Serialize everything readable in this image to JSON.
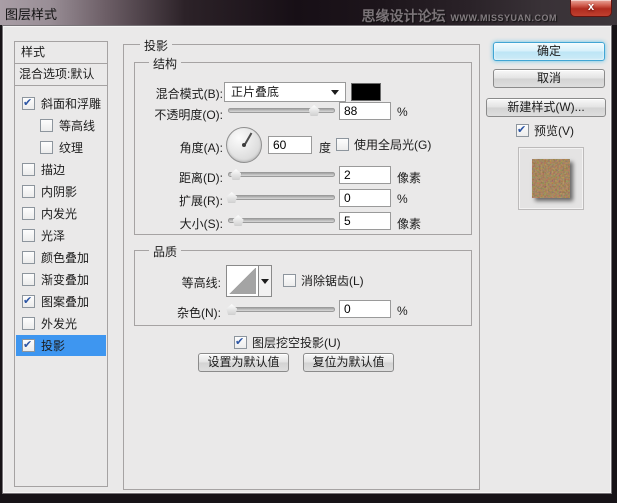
{
  "window": {
    "title": "图层样式",
    "watermark_main": "思缘设计论坛",
    "watermark_sub": "WWW.MISSYUAN.COM",
    "close_label": "x"
  },
  "sidebar": {
    "header": "样式",
    "blending_options": "混合选项:默认",
    "items": [
      {
        "label": "斜面和浮雕",
        "checked": true,
        "indent": false,
        "selected": false
      },
      {
        "label": "等高线",
        "checked": false,
        "indent": true,
        "selected": false
      },
      {
        "label": "纹理",
        "checked": false,
        "indent": true,
        "selected": false
      },
      {
        "label": "描边",
        "checked": false,
        "indent": false,
        "selected": false
      },
      {
        "label": "内阴影",
        "checked": false,
        "indent": false,
        "selected": false
      },
      {
        "label": "内发光",
        "checked": false,
        "indent": false,
        "selected": false
      },
      {
        "label": "光泽",
        "checked": false,
        "indent": false,
        "selected": false
      },
      {
        "label": "颜色叠加",
        "checked": false,
        "indent": false,
        "selected": false
      },
      {
        "label": "渐变叠加",
        "checked": false,
        "indent": false,
        "selected": false
      },
      {
        "label": "图案叠加",
        "checked": true,
        "indent": false,
        "selected": false
      },
      {
        "label": "外发光",
        "checked": false,
        "indent": false,
        "selected": false
      },
      {
        "label": "投影",
        "checked": true,
        "indent": false,
        "selected": true
      }
    ]
  },
  "panel": {
    "group_title": "投影",
    "structure": {
      "title": "结构",
      "blend_mode_label": "混合模式(B):",
      "blend_mode_value": "正片叠底",
      "shadow_color": "#000000",
      "opacity_label": "不透明度(O):",
      "opacity_value": "88",
      "opacity_unit": "%",
      "angle_label": "角度(A):",
      "angle_value": "60",
      "angle_unit": "度",
      "angle_degrees": 60,
      "global_light_label": "使用全局光(G)",
      "distance_label": "距离(D):",
      "distance_value": "2",
      "distance_unit": "像素",
      "spread_label": "扩展(R):",
      "spread_value": "0",
      "spread_unit": "%",
      "size_label": "大小(S):",
      "size_value": "5",
      "size_unit": "像素"
    },
    "quality": {
      "title": "品质",
      "contour_label": "等高线:",
      "antialias_label": "消除锯齿(L)",
      "noise_label": "杂色(N):",
      "noise_value": "0",
      "noise_unit": "%",
      "knockout_label": "图层挖空投影(U)",
      "make_default_label": "设置为默认值",
      "reset_default_label": "复位为默认值"
    }
  },
  "actions": {
    "ok": "确定",
    "cancel": "取消",
    "new_style": "新建样式(W)...",
    "preview": "预览(V)"
  },
  "checkboxes": {
    "global_light": false,
    "antialias": false,
    "knockout": true,
    "preview": true
  },
  "sliders": {
    "opacity": {
      "pct": 80
    },
    "distance": {
      "pct": 7
    },
    "spread": {
      "pct": 3
    },
    "size": {
      "pct": 9
    },
    "noise": {
      "pct": 3
    }
  },
  "colors": {
    "selection_blue": "#3e96f0",
    "dialog_bg": "#eae9e9",
    "close_red": "#b02c1f",
    "texture_brown": "#5d3d20"
  }
}
